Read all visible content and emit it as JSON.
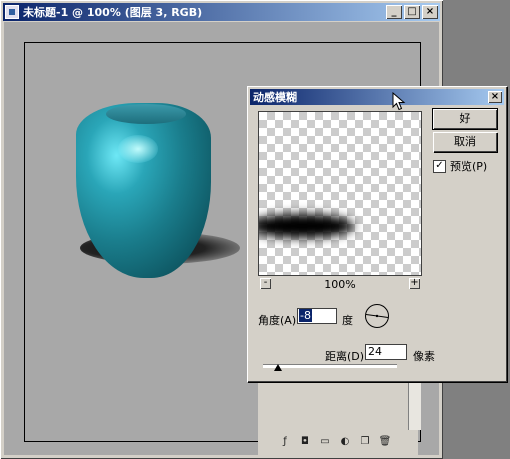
{
  "document_window": {
    "title": "未标题-1 @ 100% (图层 3, RGB)",
    "buttons": {
      "minimize": "_",
      "maximize": "□",
      "close": "×"
    }
  },
  "dialog": {
    "title": "动感模糊",
    "close": "×",
    "ok_label": "好",
    "cancel_label": "取消",
    "preview_label": "预览(P)",
    "preview_checked": true,
    "zoom_minus": "-",
    "zoom_plus": "+",
    "zoom_level": "100%",
    "angle_label": "角度(A):",
    "angle_value": "-8",
    "angle_unit": "度",
    "distance_label": "距离(D):",
    "distance_value": "24",
    "distance_unit": "像素"
  },
  "colors": {
    "title_active": "#0a246a",
    "vase": "#1a7d8c",
    "face": "#d4d0c8"
  }
}
